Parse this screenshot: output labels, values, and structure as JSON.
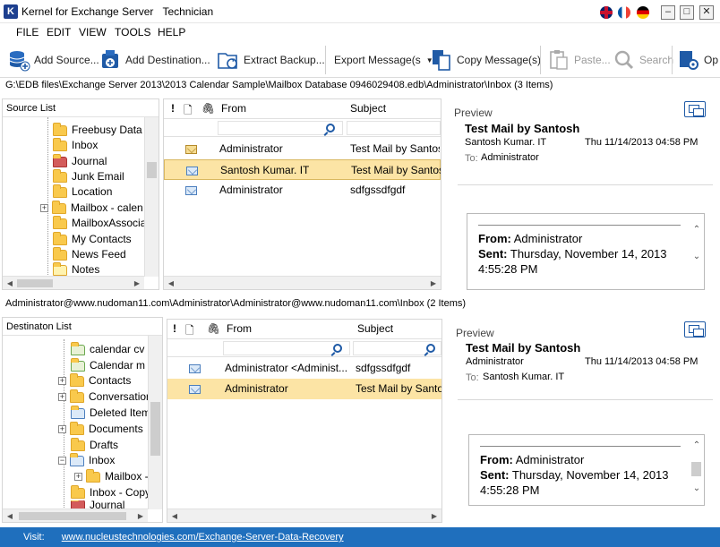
{
  "window": {
    "title": "Kernel for Exchange Server",
    "edition": "Technician",
    "app_icon": "K"
  },
  "menu": [
    "FILE",
    "EDIT",
    "VIEW",
    "TOOLS",
    "HELP"
  ],
  "toolbar": {
    "add_source": "Add Source...",
    "add_destination": "Add Destination...",
    "extract_backup": "Extract Backup...",
    "export_messages": "Export Message(s",
    "copy_messages": "Copy Message(s)",
    "paste": "Paste...",
    "search": "Search",
    "options": "Op"
  },
  "source": {
    "path": "G:\\EDB files\\Exchange Server 2013\\2013 Calendar Sample\\Mailbox Database 0946029408.edb\\Administrator\\Inbox   (3 Items)",
    "panel_title": "Source List",
    "tree": [
      {
        "label": "Freebusy Data",
        "icon": "folder-icon"
      },
      {
        "label": "Inbox",
        "icon": "folder-icon"
      },
      {
        "label": "Journal",
        "icon": "journal-icon"
      },
      {
        "label": "Junk Email",
        "icon": "folder-icon"
      },
      {
        "label": "Location",
        "icon": "folder-icon"
      },
      {
        "label": "Mailbox - calen",
        "icon": "folder-icon"
      },
      {
        "label": "MailboxAssocia",
        "icon": "folder-icon"
      },
      {
        "label": "My Contacts",
        "icon": "folder-icon"
      },
      {
        "label": "News Feed",
        "icon": "folder-icon"
      },
      {
        "label": "Notes",
        "icon": "notes-icon"
      }
    ],
    "columns": {
      "from": "From",
      "subject": "Subject"
    },
    "messages": [
      {
        "from": "Administrator",
        "subject": "Test  Mail by Santosh",
        "icon": "envelope-icon"
      },
      {
        "from": "Santosh Kumar. IT",
        "subject": "Test  Mail by Santosh",
        "icon": "envelope-open-icon"
      },
      {
        "from": "Administrator",
        "subject": "sdfgssdfgdf",
        "icon": "envelope-open-icon"
      }
    ],
    "preview": {
      "label": "Preview",
      "subject": "Test  Mail by  Santosh",
      "sender": "Santosh Kumar. IT",
      "date": "Thu 11/14/2013 04:58 PM",
      "to_label": "To:",
      "to": "Administrator",
      "body_from_label": "From:",
      "body_from": "Administrator",
      "body_sent_label": "Sent:",
      "body_sent": "Thursday, November 14, 2013",
      "body_time": "4:55:28 PM"
    }
  },
  "destination": {
    "path": "Administrator@www.nudoman11.com\\Administrator\\Administrator@www.nudoman11.com\\Inbox   (2 Items)",
    "panel_title": "Destinaton List",
    "tree": [
      {
        "label": "calendar  cv",
        "icon": "calendar-icon"
      },
      {
        "label": "Calendar  m",
        "icon": "calendar-icon"
      },
      {
        "label": "Contacts",
        "icon": "folder-icon"
      },
      {
        "label": "Conversation",
        "icon": "folder-icon"
      },
      {
        "label": "Deleted Item",
        "icon": "deleted-items-icon"
      },
      {
        "label": "Documents",
        "icon": "folder-icon"
      },
      {
        "label": "Drafts",
        "icon": "folder-icon"
      },
      {
        "label": "Inbox",
        "icon": "inbox-icon"
      },
      {
        "label": "Mailbox -",
        "icon": "folder-icon"
      },
      {
        "label": "Inbox - Copy",
        "icon": "folder-icon"
      },
      {
        "label": "Journal",
        "icon": "journal-icon"
      }
    ],
    "columns": {
      "from": "From",
      "subject": "Subject"
    },
    "messages": [
      {
        "from": "Administrator <Administ...",
        "subject": "sdfgssdfgdf",
        "icon": "envelope-open-icon"
      },
      {
        "from": "Administrator",
        "subject": "Test Mail by Santosh",
        "icon": "envelope-open-icon"
      }
    ],
    "preview": {
      "label": "Preview",
      "subject": "Test Mail by  Santosh",
      "sender": "Administrator",
      "date": "Thu 11/14/2013 04:58 PM",
      "to_label": "To:",
      "to": "Santosh Kumar. IT",
      "body_from_label": "From:",
      "body_from": "Administrator",
      "body_sent_label": "Sent:",
      "body_sent": "Thursday, November 14, 2013",
      "body_time": "4:55:28 PM"
    }
  },
  "footer": {
    "visit_label": "Visit:",
    "url": "www.nucleustechnologies.com/Exchange-Server-Data-Recovery"
  }
}
